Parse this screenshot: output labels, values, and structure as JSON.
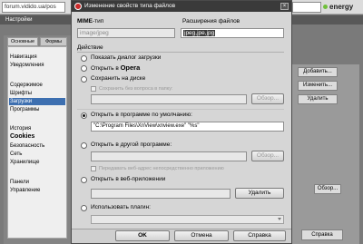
{
  "browser": {
    "url": "forum.vidido.ua/pos",
    "brand": "energy"
  },
  "prefs": {
    "title": "Настройки",
    "tabs": [
      "Основные",
      "Формы"
    ],
    "sidebar": [
      {
        "label": "Навигация"
      },
      {
        "label": "Уведомления"
      },
      {
        "label": "Содержимое"
      },
      {
        "label": "Шрифты"
      },
      {
        "label": "Загрузки"
      },
      {
        "label": "Программы"
      },
      {
        "label": "История"
      },
      {
        "label": "Cookies"
      },
      {
        "label": "Безопасность"
      },
      {
        "label": "Сеть"
      },
      {
        "label": "Хранилище"
      },
      {
        "label": "Панели"
      },
      {
        "label": "Управление"
      }
    ],
    "right_buttons": {
      "add": "Добавить...",
      "change": "Изменить...",
      "delete": "Удалить",
      "browse": "Обзор..."
    },
    "help": "Справка"
  },
  "dialog": {
    "title": "Изменение свойств типа файлов",
    "mime_label_bold": "MIME",
    "mime_label_rest": "-тип",
    "mime_value": "image/jpeg",
    "ext_label": "Расширения файлов",
    "ext_value": "jpeg,jpe,jpg",
    "action_label": "Действие",
    "options": {
      "show_dialog": "Показать диалог загрузки",
      "open_in_opera_prefix": "Открыть в ",
      "open_in_opera_name": "Opera",
      "save_to_disk": "Сохранить на диске",
      "save_no_ask": "Сохранить без вопроса в папку:",
      "open_default": "Открыть в программе по умолчанию:",
      "default_path": "\"C:\\Program Files\\XnView\\xnview.exe\" \"%s\"",
      "open_other": "Открыть в другой программе:",
      "pass_url": "Передавать веб-адрес непосредственно приложению",
      "open_webapp": "Открыть в веб-приложении",
      "use_plugin": "Использовать плагин:"
    },
    "buttons": {
      "browse": "Обзор...",
      "delete": "Удалить",
      "ok": "OK",
      "cancel": "Отмена",
      "help": "Справка"
    }
  }
}
